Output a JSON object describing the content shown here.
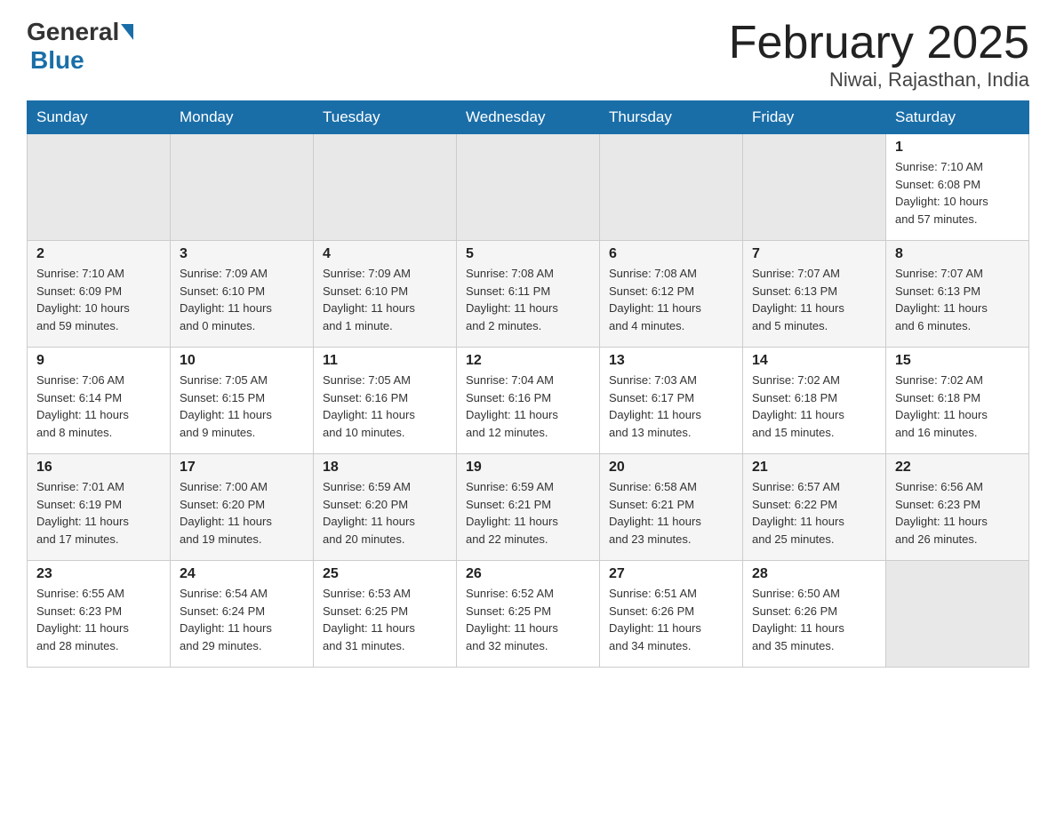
{
  "header": {
    "logo": {
      "general": "General",
      "blue": "Blue"
    },
    "title": "February 2025",
    "location": "Niwai, Rajasthan, India"
  },
  "days_of_week": [
    "Sunday",
    "Monday",
    "Tuesday",
    "Wednesday",
    "Thursday",
    "Friday",
    "Saturday"
  ],
  "weeks": [
    {
      "cells": [
        {
          "day": "",
          "detail": ""
        },
        {
          "day": "",
          "detail": ""
        },
        {
          "day": "",
          "detail": ""
        },
        {
          "day": "",
          "detail": ""
        },
        {
          "day": "",
          "detail": ""
        },
        {
          "day": "",
          "detail": ""
        },
        {
          "day": "1",
          "detail": "Sunrise: 7:10 AM\nSunset: 6:08 PM\nDaylight: 10 hours\nand 57 minutes."
        }
      ]
    },
    {
      "cells": [
        {
          "day": "2",
          "detail": "Sunrise: 7:10 AM\nSunset: 6:09 PM\nDaylight: 10 hours\nand 59 minutes."
        },
        {
          "day": "3",
          "detail": "Sunrise: 7:09 AM\nSunset: 6:10 PM\nDaylight: 11 hours\nand 0 minutes."
        },
        {
          "day": "4",
          "detail": "Sunrise: 7:09 AM\nSunset: 6:10 PM\nDaylight: 11 hours\nand 1 minute."
        },
        {
          "day": "5",
          "detail": "Sunrise: 7:08 AM\nSunset: 6:11 PM\nDaylight: 11 hours\nand 2 minutes."
        },
        {
          "day": "6",
          "detail": "Sunrise: 7:08 AM\nSunset: 6:12 PM\nDaylight: 11 hours\nand 4 minutes."
        },
        {
          "day": "7",
          "detail": "Sunrise: 7:07 AM\nSunset: 6:13 PM\nDaylight: 11 hours\nand 5 minutes."
        },
        {
          "day": "8",
          "detail": "Sunrise: 7:07 AM\nSunset: 6:13 PM\nDaylight: 11 hours\nand 6 minutes."
        }
      ]
    },
    {
      "cells": [
        {
          "day": "9",
          "detail": "Sunrise: 7:06 AM\nSunset: 6:14 PM\nDaylight: 11 hours\nand 8 minutes."
        },
        {
          "day": "10",
          "detail": "Sunrise: 7:05 AM\nSunset: 6:15 PM\nDaylight: 11 hours\nand 9 minutes."
        },
        {
          "day": "11",
          "detail": "Sunrise: 7:05 AM\nSunset: 6:16 PM\nDaylight: 11 hours\nand 10 minutes."
        },
        {
          "day": "12",
          "detail": "Sunrise: 7:04 AM\nSunset: 6:16 PM\nDaylight: 11 hours\nand 12 minutes."
        },
        {
          "day": "13",
          "detail": "Sunrise: 7:03 AM\nSunset: 6:17 PM\nDaylight: 11 hours\nand 13 minutes."
        },
        {
          "day": "14",
          "detail": "Sunrise: 7:02 AM\nSunset: 6:18 PM\nDaylight: 11 hours\nand 15 minutes."
        },
        {
          "day": "15",
          "detail": "Sunrise: 7:02 AM\nSunset: 6:18 PM\nDaylight: 11 hours\nand 16 minutes."
        }
      ]
    },
    {
      "cells": [
        {
          "day": "16",
          "detail": "Sunrise: 7:01 AM\nSunset: 6:19 PM\nDaylight: 11 hours\nand 17 minutes."
        },
        {
          "day": "17",
          "detail": "Sunrise: 7:00 AM\nSunset: 6:20 PM\nDaylight: 11 hours\nand 19 minutes."
        },
        {
          "day": "18",
          "detail": "Sunrise: 6:59 AM\nSunset: 6:20 PM\nDaylight: 11 hours\nand 20 minutes."
        },
        {
          "day": "19",
          "detail": "Sunrise: 6:59 AM\nSunset: 6:21 PM\nDaylight: 11 hours\nand 22 minutes."
        },
        {
          "day": "20",
          "detail": "Sunrise: 6:58 AM\nSunset: 6:21 PM\nDaylight: 11 hours\nand 23 minutes."
        },
        {
          "day": "21",
          "detail": "Sunrise: 6:57 AM\nSunset: 6:22 PM\nDaylight: 11 hours\nand 25 minutes."
        },
        {
          "day": "22",
          "detail": "Sunrise: 6:56 AM\nSunset: 6:23 PM\nDaylight: 11 hours\nand 26 minutes."
        }
      ]
    },
    {
      "cells": [
        {
          "day": "23",
          "detail": "Sunrise: 6:55 AM\nSunset: 6:23 PM\nDaylight: 11 hours\nand 28 minutes."
        },
        {
          "day": "24",
          "detail": "Sunrise: 6:54 AM\nSunset: 6:24 PM\nDaylight: 11 hours\nand 29 minutes."
        },
        {
          "day": "25",
          "detail": "Sunrise: 6:53 AM\nSunset: 6:25 PM\nDaylight: 11 hours\nand 31 minutes."
        },
        {
          "day": "26",
          "detail": "Sunrise: 6:52 AM\nSunset: 6:25 PM\nDaylight: 11 hours\nand 32 minutes."
        },
        {
          "day": "27",
          "detail": "Sunrise: 6:51 AM\nSunset: 6:26 PM\nDaylight: 11 hours\nand 34 minutes."
        },
        {
          "day": "28",
          "detail": "Sunrise: 6:50 AM\nSunset: 6:26 PM\nDaylight: 11 hours\nand 35 minutes."
        },
        {
          "day": "",
          "detail": ""
        }
      ]
    }
  ]
}
